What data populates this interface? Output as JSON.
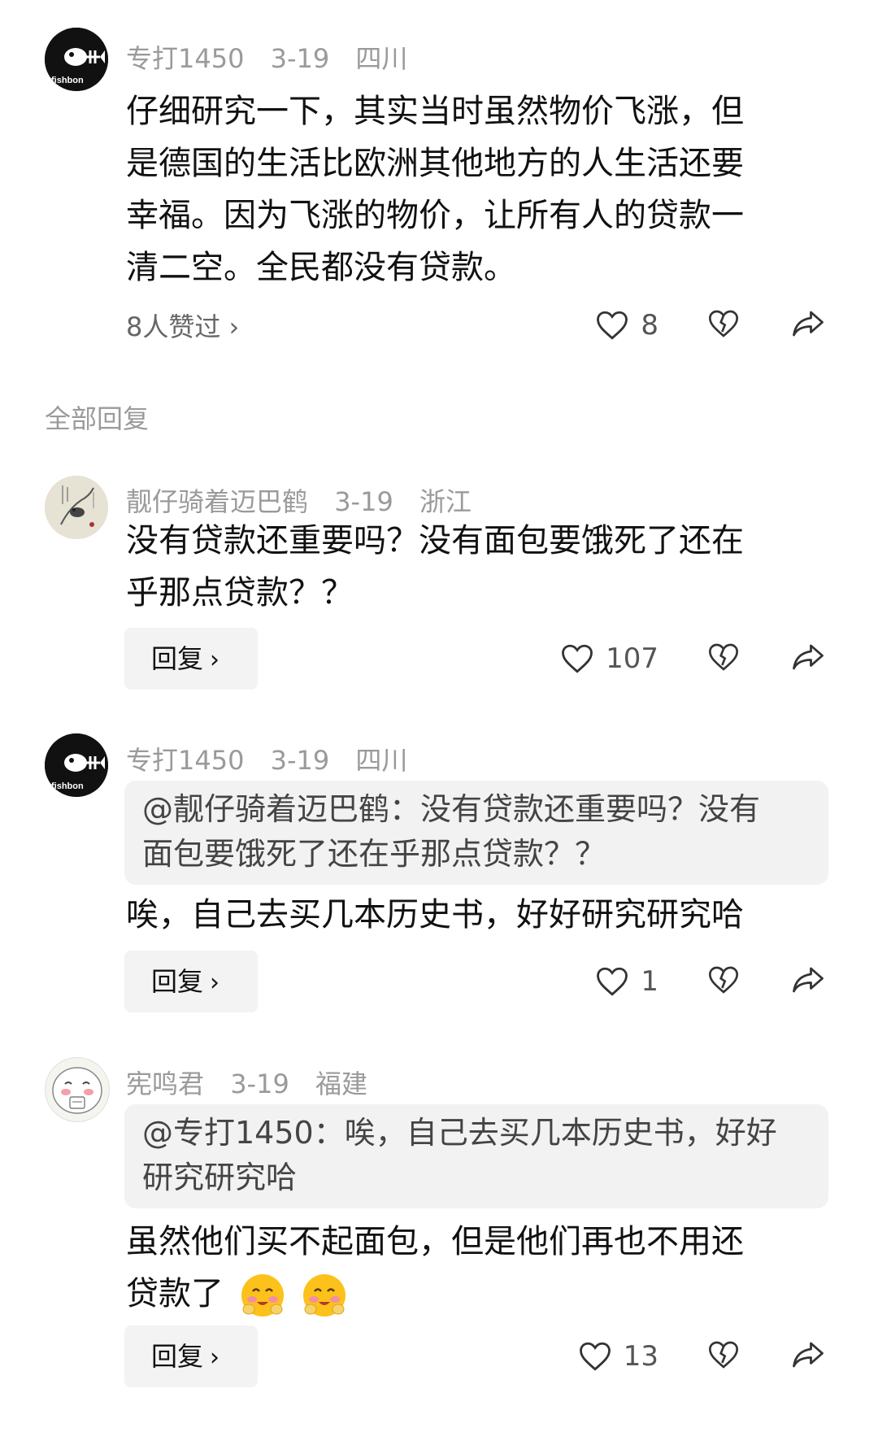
{
  "comments": [
    {
      "user": "专打1450",
      "date": "3-19",
      "location": "四川",
      "lines": [
        "仔细研究一下，其实当时虽然物价飞涨，但",
        "是德国的生活比欧洲其他地方的人生活还要",
        "幸福。因为飞涨的物价，让所有人的贷款一",
        "清二空。全民都没有贷款。"
      ],
      "likes_summary": "8人赞过 ›",
      "like_count": "8"
    }
  ],
  "section_title": "全部回复",
  "replies": [
    {
      "user": "靓仔骑着迈巴鹤",
      "date": "3-19",
      "location": "浙江",
      "lines": [
        "没有贷款还重要吗？没有面包要饿死了还在",
        "乎那点贷款？？"
      ],
      "reply_label": "回复",
      "like_count": "107"
    },
    {
      "user": "专打1450",
      "date": "3-19",
      "location": "四川",
      "quote_lines": [
        "@靓仔骑着迈巴鹤：没有贷款还重要吗？没有",
        "面包要饿死了还在乎那点贷款？？"
      ],
      "lines": [
        "唉，自己去买几本历史书，好好研究研究哈"
      ],
      "reply_label": "回复",
      "like_count": "1"
    },
    {
      "user": "宪鸣君",
      "date": "3-19",
      "location": "福建",
      "quote_lines": [
        "@专打1450：唉，自己去买几本历史书，好好",
        "研究研究哈"
      ],
      "lines": [
        "虽然他们买不起面包，但是他们再也不用还",
        "贷款了"
      ],
      "reply_label": "回复",
      "like_count": "13"
    }
  ],
  "icons": [
    "fishbone-avatar",
    "ink-painting-avatar",
    "cartoon-face-avatar",
    "heart-icon",
    "broken-heart-icon",
    "share-arrow-icon",
    "smiling-face-emoji"
  ],
  "colors": {
    "meta_text": "#9a9a9a",
    "bubble_bg": "#f2f2f2",
    "icon_stroke": "#333333"
  }
}
